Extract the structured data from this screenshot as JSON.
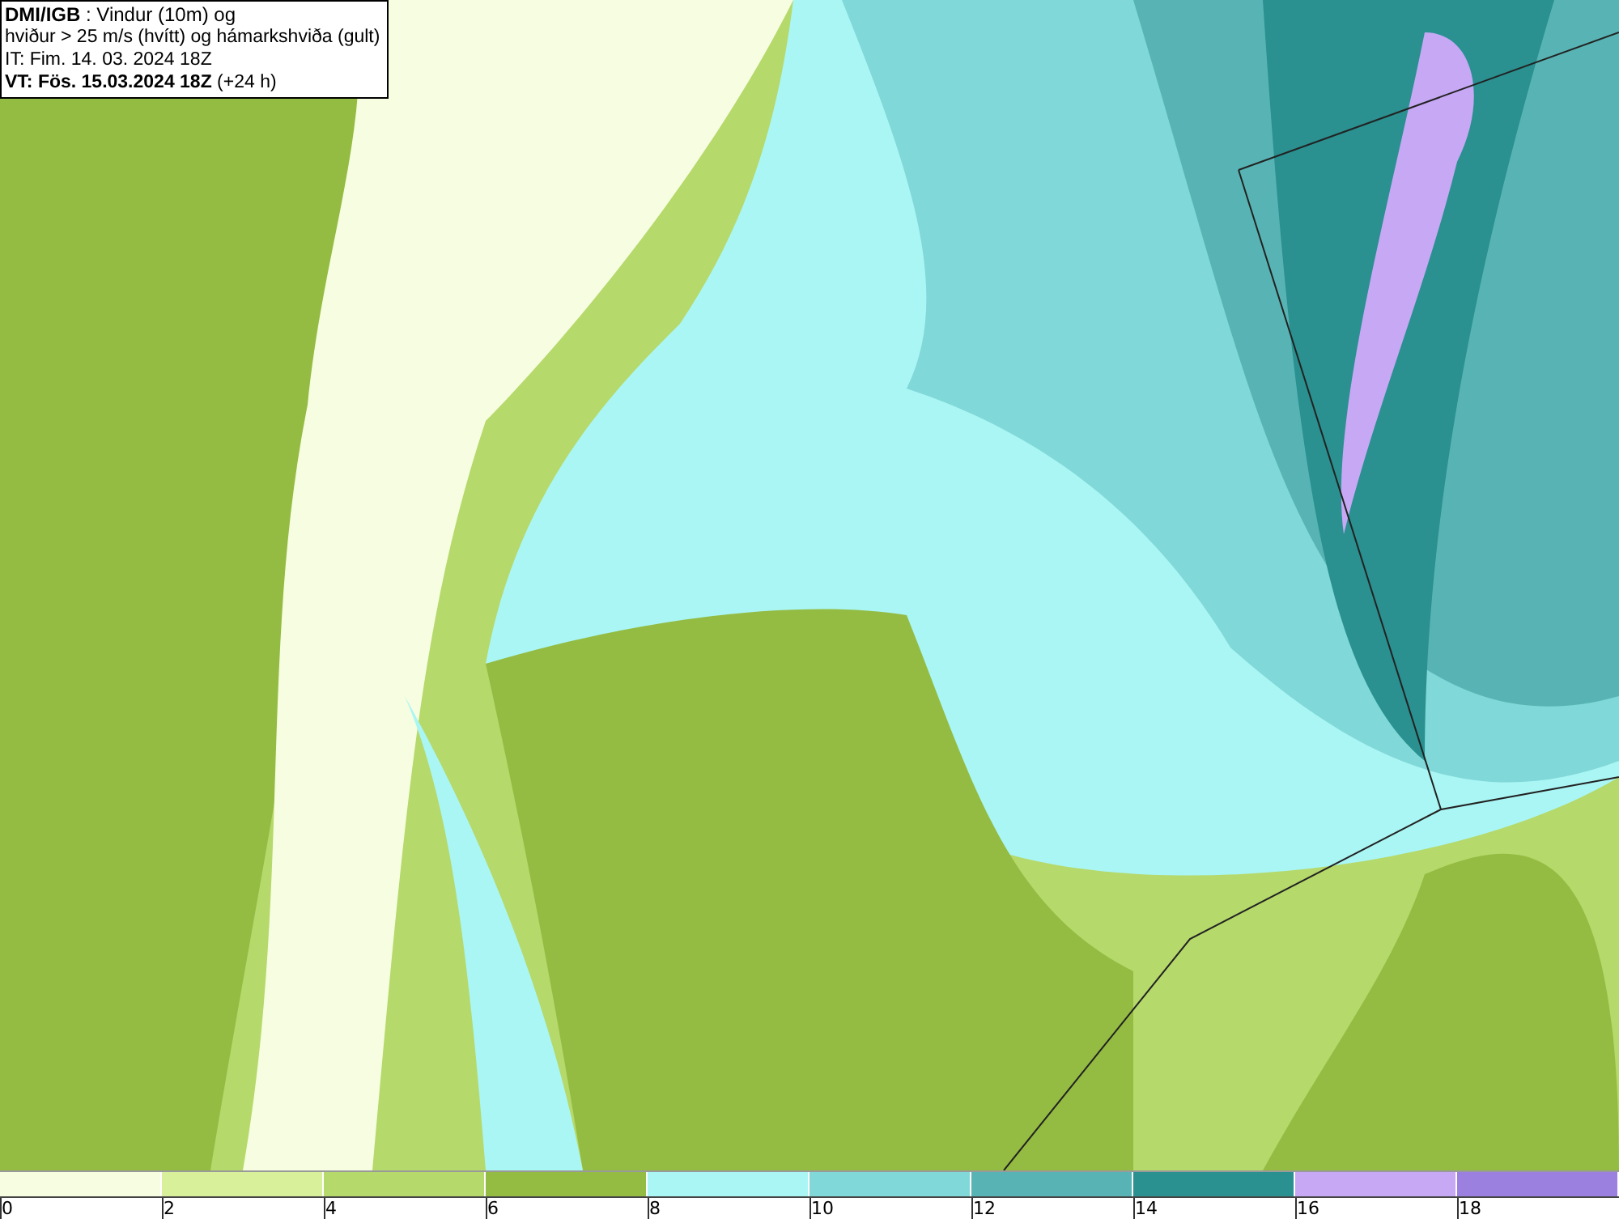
{
  "info_box": {
    "lines": [
      "**DMI/IGB** : Vindur (10m) og",
      "hviður > 25 m/s (hvítt) og hámarkshviða (gult)",
      "IT: Fim. 14. 03. 2024 18Z",
      "**VT: Fös. 15.03.2024 18Z** (+24 h)"
    ]
  },
  "legend": {
    "bins": [
      {
        "color": "#f7fde0",
        "label": "0"
      },
      {
        "color": "#d8f09a",
        "label": "2"
      },
      {
        "color": "#b5d96a",
        "label": "4"
      },
      {
        "color": "#94bc42",
        "label": "6"
      },
      {
        "color": "#aaf6f4",
        "label": "8"
      },
      {
        "color": "#80d8d8",
        "label": "10"
      },
      {
        "color": "#58b4b4",
        "label": "12"
      },
      {
        "color": "#2a9090",
        "label": "14"
      },
      {
        "color": "#c7a8f5",
        "label": "16"
      },
      {
        "color": "#9b80e0",
        "label": "18"
      }
    ]
  }
}
